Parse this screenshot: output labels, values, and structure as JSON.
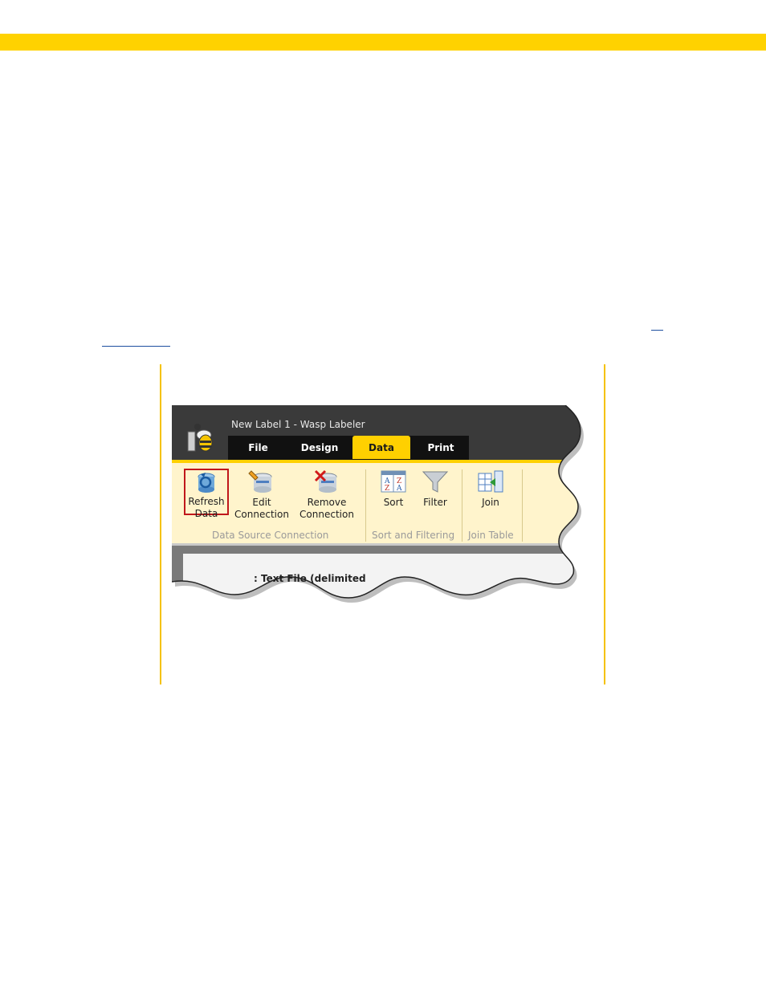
{
  "window": {
    "title": "New Label 1 - Wasp Labeler"
  },
  "tabs": [
    {
      "label": "File"
    },
    {
      "label": "Design"
    },
    {
      "label": "Data"
    },
    {
      "label": "Print"
    }
  ],
  "ribbon": {
    "groups": [
      {
        "label": "Data Source Connection"
      },
      {
        "label": "Sort and Filtering"
      },
      {
        "label": "Join Table"
      }
    ],
    "buttons": {
      "refresh": {
        "line1": "Refresh",
        "line2": "Data"
      },
      "edit": {
        "line1": "Edit",
        "line2": "Connection"
      },
      "remove": {
        "line1": "Remove",
        "line2": "Connection"
      },
      "sort": {
        "line1": "Sort"
      },
      "filter": {
        "line1": "Filter"
      },
      "join": {
        "line1": "Join"
      }
    }
  },
  "content": {
    "partial_text": ": Text File (delimited"
  },
  "colors": {
    "brand_yellow": "#FFD200",
    "active_tab": "#FFD000",
    "ribbon_bg": "#FFF4CC",
    "highlight": "#c0171b"
  }
}
